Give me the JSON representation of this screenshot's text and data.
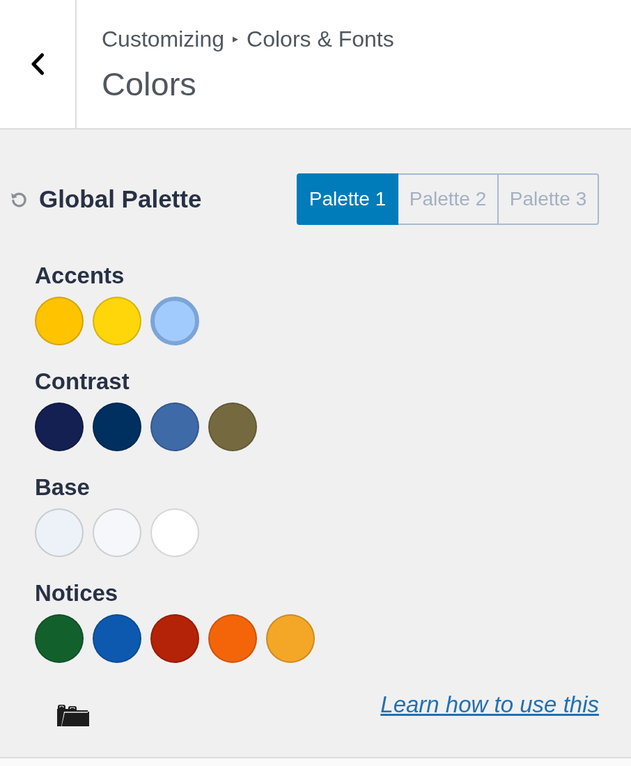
{
  "header": {
    "breadcrumb": {
      "parent": "Customizing",
      "separator": "▸",
      "current": "Colors & Fonts"
    },
    "title": "Colors"
  },
  "palette": {
    "title": "Global Palette",
    "tabs": [
      {
        "label": "Palette 1",
        "selected": true
      },
      {
        "label": "Palette 2",
        "selected": false
      },
      {
        "label": "Palette 3",
        "selected": false
      }
    ]
  },
  "groups": [
    {
      "label": "Accents",
      "swatches": [
        {
          "color": "#ffc300",
          "selected": false
        },
        {
          "color": "#ffd60a",
          "selected": false
        },
        {
          "color": "#a2cbfd",
          "selected": true
        }
      ]
    },
    {
      "label": "Contrast",
      "swatches": [
        {
          "color": "#141f52",
          "selected": false
        },
        {
          "color": "#003060",
          "selected": false
        },
        {
          "color": "#3e6aa7",
          "selected": false
        },
        {
          "color": "#756a3f",
          "selected": false
        }
      ]
    },
    {
      "label": "Base",
      "swatches": [
        {
          "color": "#edf2f8",
          "selected": false
        },
        {
          "color": "#f5f7fa",
          "selected": false
        },
        {
          "color": "#ffffff",
          "selected": false
        }
      ]
    },
    {
      "label": "Notices",
      "swatches": [
        {
          "color": "#12612d",
          "selected": false
        },
        {
          "color": "#0e59b0",
          "selected": false
        },
        {
          "color": "#b42207",
          "selected": false
        },
        {
          "color": "#f46509",
          "selected": false
        },
        {
          "color": "#f4a627",
          "selected": false
        }
      ]
    }
  ],
  "footer": {
    "link": "Learn how to use this"
  }
}
